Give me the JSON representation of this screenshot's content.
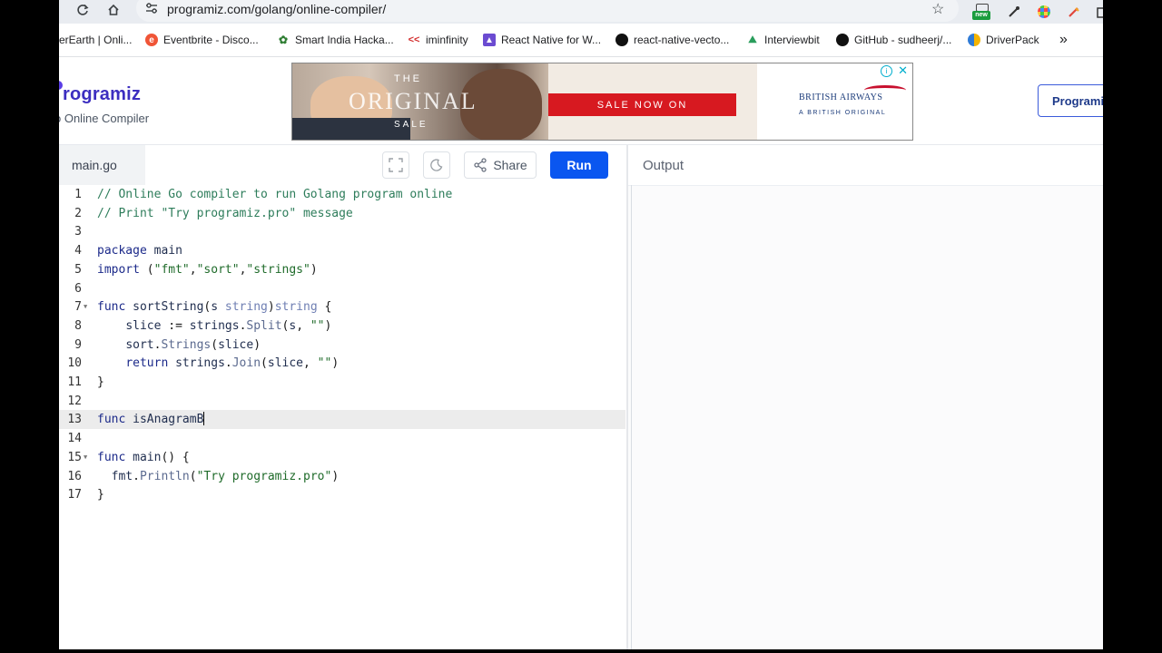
{
  "browser": {
    "url": "programiz.com/golang/online-compiler/",
    "extension_badge": "new",
    "bookmarks": [
      {
        "label": "erEarth | Onli...",
        "icon": "hackerearth-icon"
      },
      {
        "label": "Eventbrite - Disco...",
        "icon": "eventbrite-icon"
      },
      {
        "label": "Smart India Hacka...",
        "icon": "sih-icon"
      },
      {
        "label": "iminfinity",
        "icon": "iminfinity-icon"
      },
      {
        "label": "React Native for W...",
        "icon": "react-native-icon"
      },
      {
        "label": "react-native-vecto...",
        "icon": "github-icon"
      },
      {
        "label": "Interviewbit",
        "icon": "interviewbit-icon"
      },
      {
        "label": "GitHub - sudheerj/...",
        "icon": "github-icon"
      },
      {
        "label": "DriverPack",
        "icon": "driverpack-icon"
      }
    ],
    "more_bookmarks": "»"
  },
  "site": {
    "logo": "rogramiz",
    "subtitle": "o Online Compiler",
    "pro_button": "Programiz"
  },
  "ad": {
    "the": "THE",
    "original": "ORIGINAL",
    "sale": "SALE",
    "cta": "SALE NOW ON",
    "brand": "BRITISH AIRWAYS",
    "tagline": "A BRITISH ORIGINAL"
  },
  "editor": {
    "filename": "main.go",
    "share_label": "Share",
    "run_label": "Run",
    "active_line": 13
  },
  "output": {
    "title": "Output"
  },
  "code_lines": [
    "// Online Go compiler to run Golang program online",
    "// Print \"Try programiz.pro\" message",
    "",
    "package main",
    "import (\"fmt\",\"sort\",\"strings\")",
    "",
    "func sortString(s string)string {",
    "    slice := strings.Split(s, \"\")",
    "    sort.Strings(slice)",
    "    return strings.Join(slice, \"\")",
    "}",
    "",
    "func isAnagramB",
    "",
    "func main() {",
    "  fmt.Println(\"Try programiz.pro\")",
    "}"
  ],
  "colors": {
    "run_button": "#0a56f0",
    "logo": "#3c2ec0",
    "comment": "#2e7d5b",
    "keyword": "#1c2a8a"
  }
}
